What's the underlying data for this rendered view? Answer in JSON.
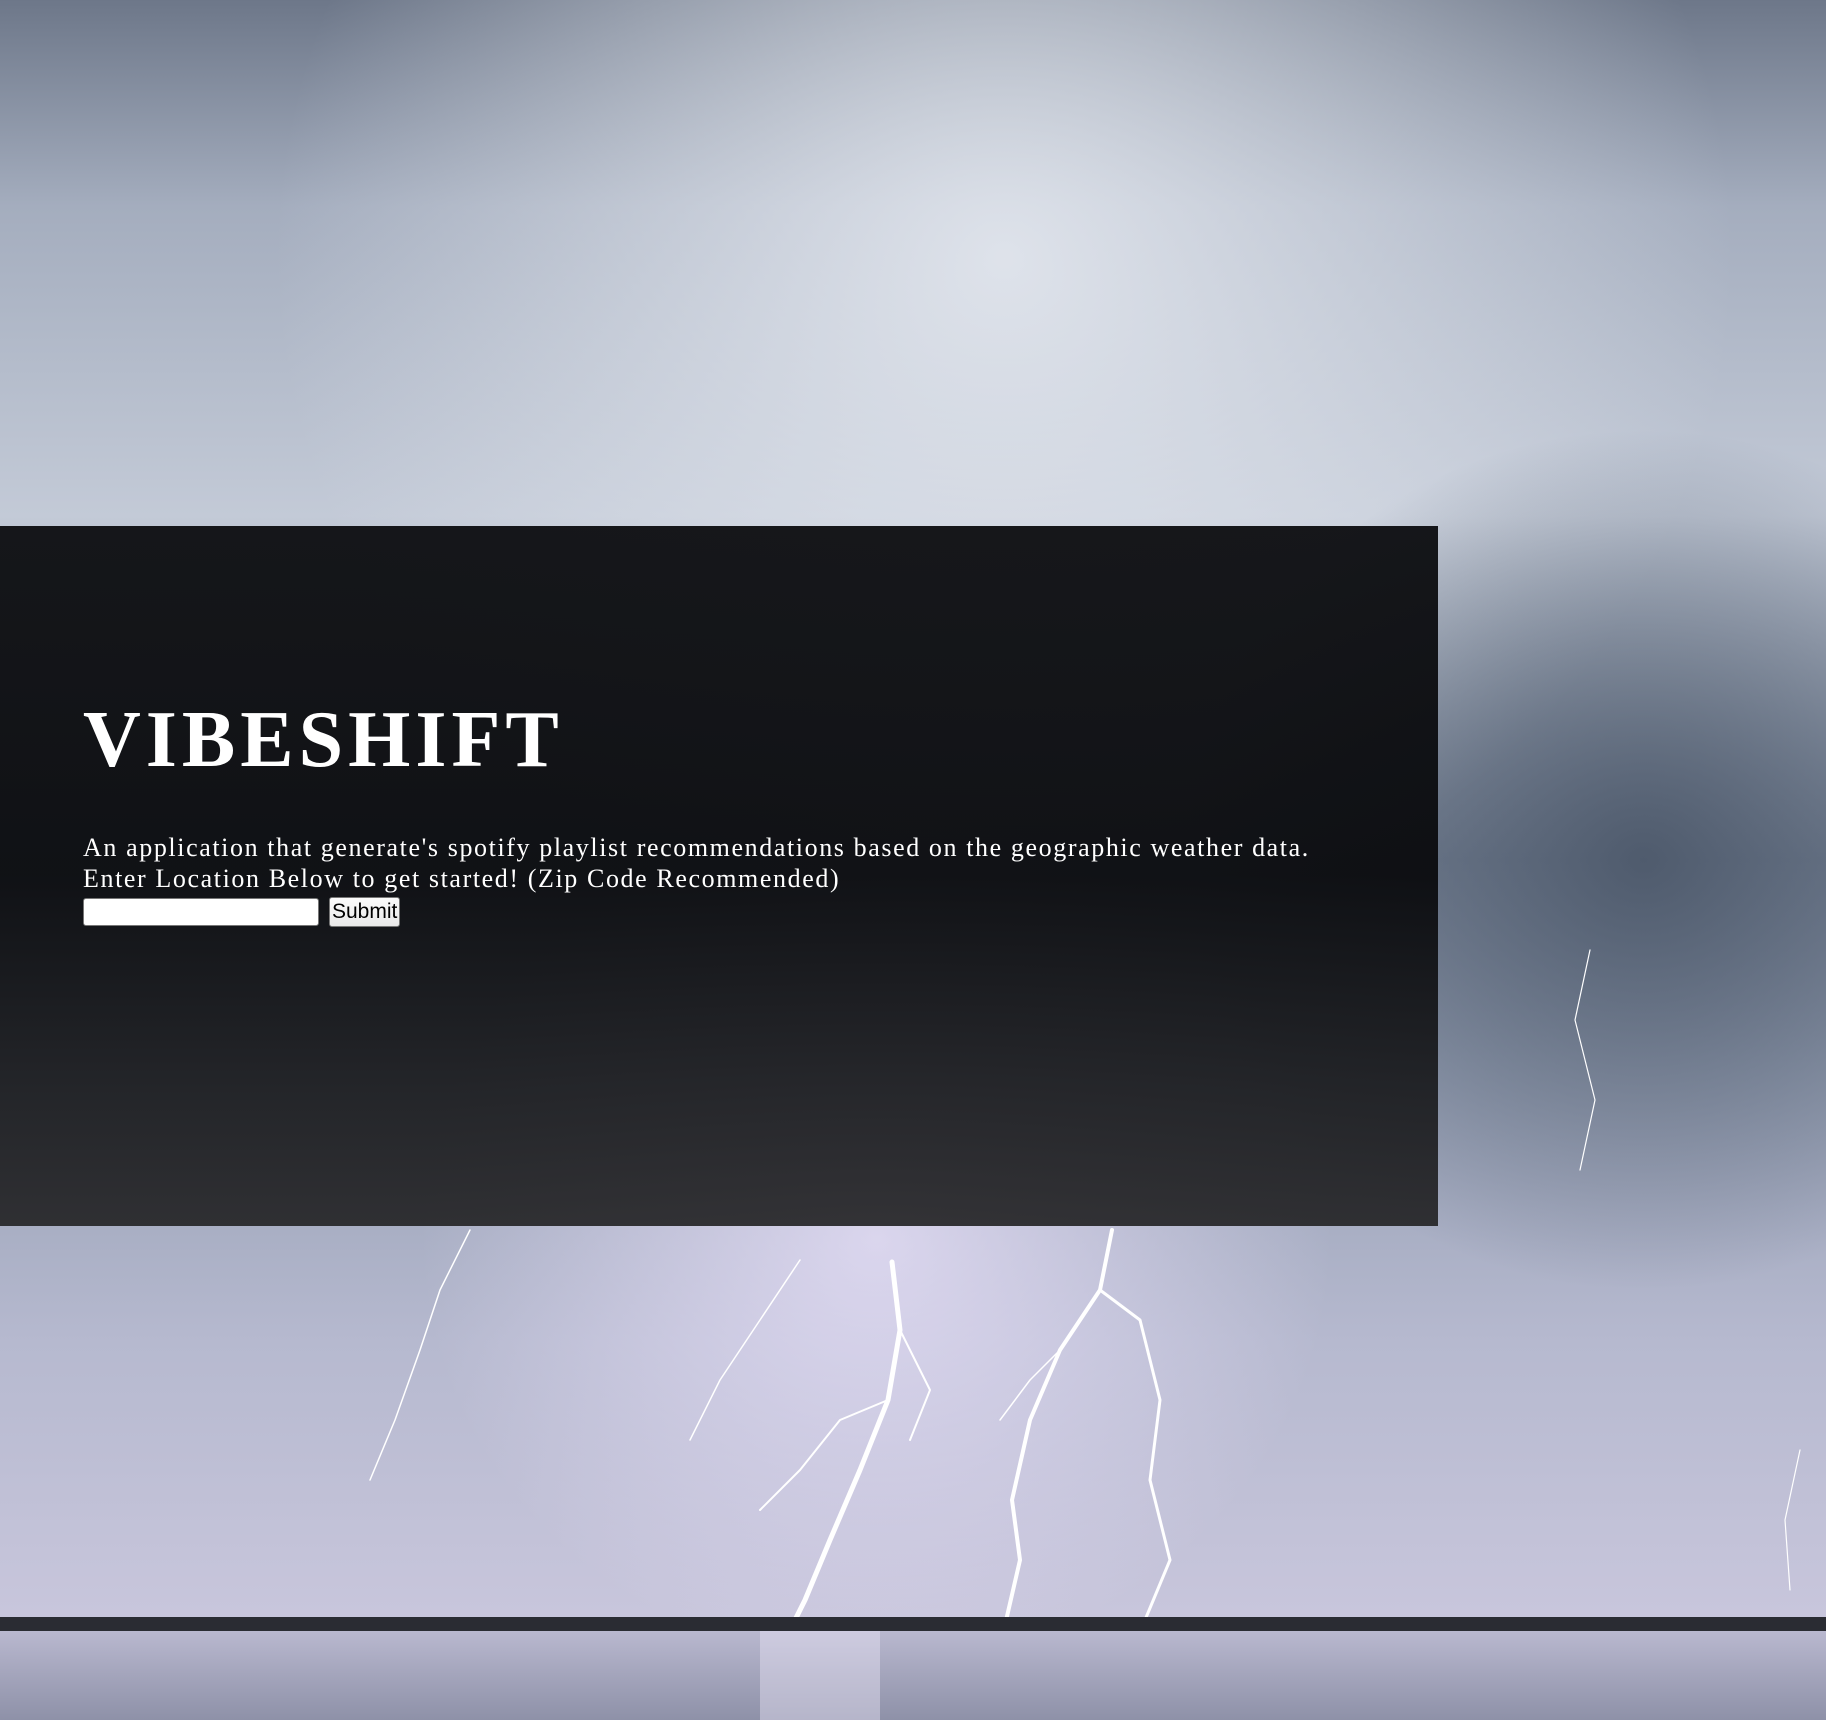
{
  "app": {
    "title": "VIBESHIFT",
    "description_line1": "An application that generate's spotify playlist recommendations based on the geographic weather data.",
    "description_line2": "Enter Location Below to get started! (Zip Code Recommended)"
  },
  "form": {
    "location_value": "",
    "submit_label": "Submit"
  },
  "colors": {
    "panel": "#0e0f12",
    "text": "#ffffff"
  },
  "background": {
    "subject": "storm-lightning-over-water"
  }
}
